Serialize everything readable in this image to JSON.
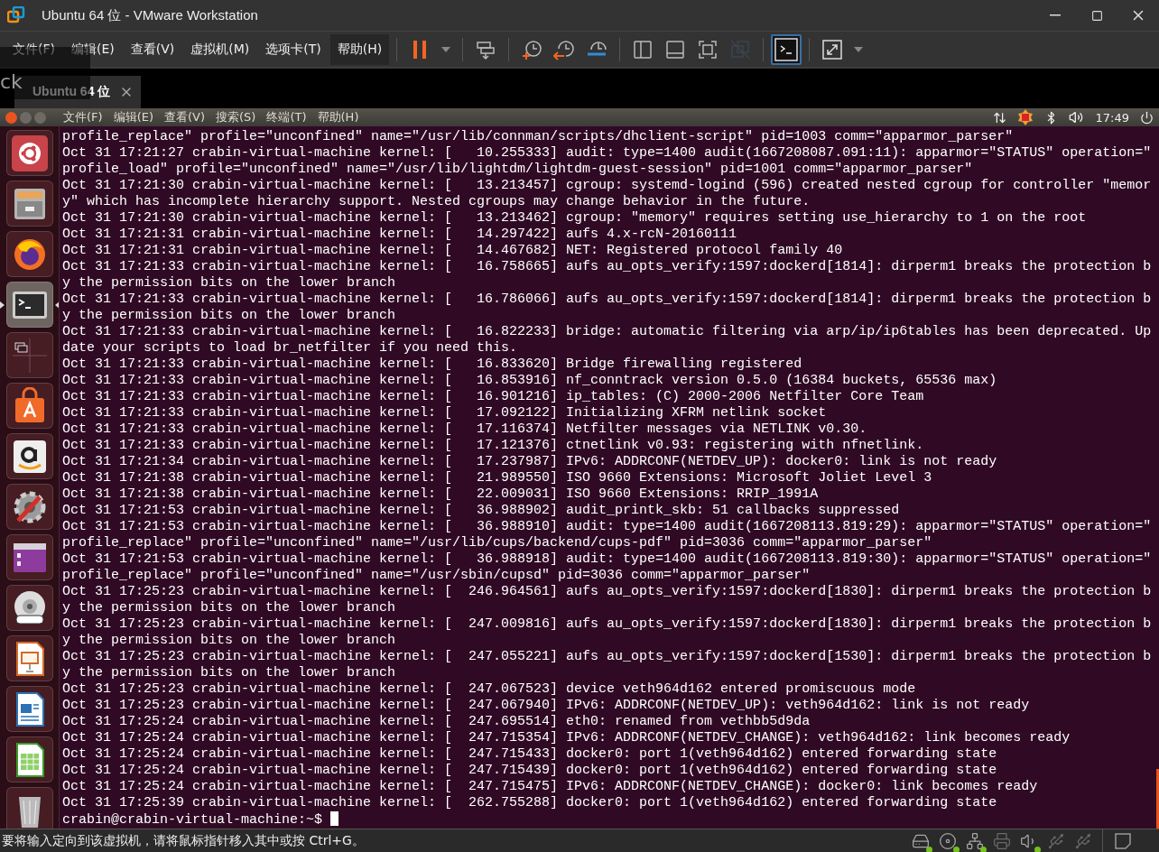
{
  "window": {
    "title": "Ubuntu 64 位 - VMware Workstation"
  },
  "menu": [
    {
      "label": "文件(F)",
      "selected": false
    },
    {
      "label": "编辑(E)",
      "selected": false
    },
    {
      "label": "查看(V)",
      "selected": false
    },
    {
      "label": "虚拟机(M)",
      "selected": false
    },
    {
      "label": "选项卡(T)",
      "selected": false
    },
    {
      "label": "帮助(H)",
      "selected": true
    }
  ],
  "toolbar": [
    {
      "kind": "pause",
      "selected": false
    },
    {
      "kind": "caret",
      "selected": false
    },
    {
      "kind": "send-keys",
      "selected": false
    },
    {
      "kind": "snapshot",
      "selected": false
    },
    {
      "kind": "revert",
      "selected": false
    },
    {
      "kind": "manage",
      "selected": false
    },
    {
      "kind": "library",
      "selected": false
    },
    {
      "kind": "thumbs",
      "selected": false
    },
    {
      "kind": "fullscreen",
      "selected": false
    },
    {
      "kind": "unity",
      "selected": false
    },
    {
      "kind": "console",
      "selected": true
    },
    {
      "kind": "stretch",
      "selected": false
    },
    {
      "kind": "caret",
      "selected": false
    }
  ],
  "tabs": [
    {
      "label": "Ubuntu 64 位",
      "selected": true
    }
  ],
  "overlay": {
    "text": "ck"
  },
  "guest_menu": [
    "文件(F)",
    "编辑(E)",
    "查看(V)",
    "搜索(S)",
    "终端(T)",
    "帮助(H)"
  ],
  "guest_clock": "17:49",
  "launcher": [
    {
      "kind": "ubuntu",
      "selected": false
    },
    {
      "kind": "files",
      "selected": false
    },
    {
      "kind": "firefox",
      "selected": false
    },
    {
      "kind": "terminal",
      "selected": true
    },
    {
      "kind": "workspaces",
      "selected": false
    },
    {
      "kind": "software",
      "selected": false
    },
    {
      "kind": "amazon",
      "selected": false
    },
    {
      "kind": "settings",
      "selected": false
    },
    {
      "kind": "purple",
      "selected": false
    },
    {
      "kind": "dvd",
      "selected": false
    },
    {
      "kind": "impress",
      "selected": false
    },
    {
      "kind": "writer",
      "selected": false
    },
    {
      "kind": "calc",
      "selected": false
    },
    {
      "kind": "trash",
      "selected": false
    }
  ],
  "terminal_lines": [
    "profile_replace\" profile=\"unconfined\" name=\"/usr/lib/connman/scripts/dhclient-script\" pid=1003 comm=\"apparmor_parser\"",
    "Oct 31 17:21:27 crabin-virtual-machine kernel: [   10.255333] audit: type=1400 audit(1667208087.091:11): apparmor=\"STATUS\" operation=\"",
    "profile_load\" profile=\"unconfined\" name=\"/usr/lib/lightdm/lightdm-guest-session\" pid=1001 comm=\"apparmor_parser\"",
    "Oct 31 17:21:30 crabin-virtual-machine kernel: [   13.213457] cgroup: systemd-logind (596) created nested cgroup for controller \"memor",
    "y\" which has incomplete hierarchy support. Nested cgroups may change behavior in the future.",
    "Oct 31 17:21:30 crabin-virtual-machine kernel: [   13.213462] cgroup: \"memory\" requires setting use_hierarchy to 1 on the root",
    "Oct 31 17:21:31 crabin-virtual-machine kernel: [   14.297422] aufs 4.x-rcN-20160111",
    "Oct 31 17:21:31 crabin-virtual-machine kernel: [   14.467682] NET: Registered protocol family 40",
    "Oct 31 17:21:33 crabin-virtual-machine kernel: [   16.758665] aufs au_opts_verify:1597:dockerd[1814]: dirperm1 breaks the protection b",
    "y the permission bits on the lower branch",
    "Oct 31 17:21:33 crabin-virtual-machine kernel: [   16.786066] aufs au_opts_verify:1597:dockerd[1814]: dirperm1 breaks the protection b",
    "y the permission bits on the lower branch",
    "Oct 31 17:21:33 crabin-virtual-machine kernel: [   16.822233] bridge: automatic filtering via arp/ip/ip6tables has been deprecated. Up",
    "date your scripts to load br_netfilter if you need this.",
    "Oct 31 17:21:33 crabin-virtual-machine kernel: [   16.833620] Bridge firewalling registered",
    "Oct 31 17:21:33 crabin-virtual-machine kernel: [   16.853916] nf_conntrack version 0.5.0 (16384 buckets, 65536 max)",
    "Oct 31 17:21:33 crabin-virtual-machine kernel: [   16.901216] ip_tables: (C) 2000-2006 Netfilter Core Team",
    "Oct 31 17:21:33 crabin-virtual-machine kernel: [   17.092122] Initializing XFRM netlink socket",
    "Oct 31 17:21:33 crabin-virtual-machine kernel: [   17.116374] Netfilter messages via NETLINK v0.30.",
    "Oct 31 17:21:33 crabin-virtual-machine kernel: [   17.121376] ctnetlink v0.93: registering with nfnetlink.",
    "Oct 31 17:21:34 crabin-virtual-machine kernel: [   17.237987] IPv6: ADDRCONF(NETDEV_UP): docker0: link is not ready",
    "Oct 31 17:21:38 crabin-virtual-machine kernel: [   21.989550] ISO 9660 Extensions: Microsoft Joliet Level 3",
    "Oct 31 17:21:38 crabin-virtual-machine kernel: [   22.009031] ISO 9660 Extensions: RRIP_1991A",
    "Oct 31 17:21:53 crabin-virtual-machine kernel: [   36.988902] audit_printk_skb: 51 callbacks suppressed",
    "Oct 31 17:21:53 crabin-virtual-machine kernel: [   36.988910] audit: type=1400 audit(1667208113.819:29): apparmor=\"STATUS\" operation=\"",
    "profile_replace\" profile=\"unconfined\" name=\"/usr/lib/cups/backend/cups-pdf\" pid=3036 comm=\"apparmor_parser\"",
    "Oct 31 17:21:53 crabin-virtual-machine kernel: [   36.988918] audit: type=1400 audit(1667208113.819:30): apparmor=\"STATUS\" operation=\"",
    "profile_replace\" profile=\"unconfined\" name=\"/usr/sbin/cupsd\" pid=3036 comm=\"apparmor_parser\"",
    "Oct 31 17:25:23 crabin-virtual-machine kernel: [  246.964561] aufs au_opts_verify:1597:dockerd[1830]: dirperm1 breaks the protection b",
    "y the permission bits on the lower branch",
    "Oct 31 17:25:23 crabin-virtual-machine kernel: [  247.009816] aufs au_opts_verify:1597:dockerd[1830]: dirperm1 breaks the protection b",
    "y the permission bits on the lower branch",
    "Oct 31 17:25:23 crabin-virtual-machine kernel: [  247.055221] aufs au_opts_verify:1597:dockerd[1530]: dirperm1 breaks the protection b",
    "y the permission bits on the lower branch",
    "Oct 31 17:25:23 crabin-virtual-machine kernel: [  247.067523] device veth964d162 entered promiscuous mode",
    "Oct 31 17:25:23 crabin-virtual-machine kernel: [  247.067940] IPv6: ADDRCONF(NETDEV_UP): veth964d162: link is not ready",
    "Oct 31 17:25:24 crabin-virtual-machine kernel: [  247.695514] eth0: renamed from vethbb5d9da",
    "Oct 31 17:25:24 crabin-virtual-machine kernel: [  247.715354] IPv6: ADDRCONF(NETDEV_CHANGE): veth964d162: link becomes ready",
    "Oct 31 17:25:24 crabin-virtual-machine kernel: [  247.715433] docker0: port 1(veth964d162) entered forwarding state",
    "Oct 31 17:25:24 crabin-virtual-machine kernel: [  247.715439] docker0: port 1(veth964d162) entered forwarding state",
    "Oct 31 17:25:24 crabin-virtual-machine kernel: [  247.715475] IPv6: ADDRCONF(NETDEV_CHANGE): docker0: link becomes ready",
    "Oct 31 17:25:39 crabin-virtual-machine kernel: [  262.755288] docker0: port 1(veth964d162) entered forwarding state"
  ],
  "prompt": "crabin@crabin-virtual-machine:~$",
  "status_bar": {
    "message": "要将输入定向到该虚拟机，请将鼠标指针移入其中或按 Ctrl+G。",
    "devices": [
      {
        "kind": "disk",
        "active": true
      },
      {
        "kind": "cd",
        "active": true
      },
      {
        "kind": "network",
        "active": true
      },
      {
        "kind": "printer",
        "active": false
      },
      {
        "kind": "sound",
        "active": true
      },
      {
        "kind": "usb",
        "active": false
      },
      {
        "kind": "usb",
        "active": false
      }
    ]
  }
}
